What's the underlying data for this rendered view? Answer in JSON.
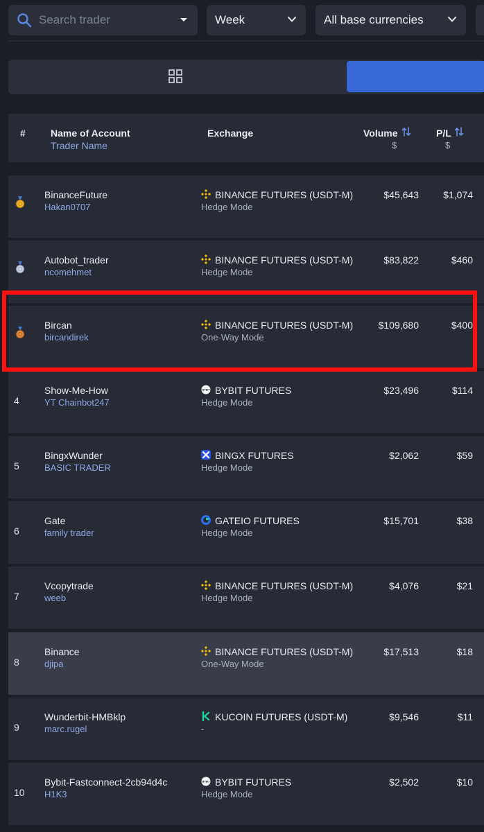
{
  "filters": {
    "search_placeholder": "Search trader",
    "period": "Week",
    "base_currency": "All base currencies"
  },
  "table": {
    "headers": {
      "rank": "#",
      "account": "Name of Account",
      "account_sub": "Trader Name",
      "exchange": "Exchange",
      "volume": "Volume",
      "volume_unit": "$",
      "pl": "P/L",
      "pl_unit": "$"
    },
    "rows": [
      {
        "rank": "",
        "medal": "gold-medal-icon",
        "name": "BinanceFuture",
        "trader": "Hakan0707",
        "exchange_icon": "binance-icon",
        "exchange": "BINANCE FUTURES (USDT-M)",
        "mode": "Hedge Mode",
        "volume": "$45,643",
        "pl": "$1,074"
      },
      {
        "rank": "",
        "medal": "silver-medal-icon",
        "name": "Autobot_trader",
        "trader": "ncomehmet",
        "exchange_icon": "binance-icon",
        "exchange": "BINANCE FUTURES (USDT-M)",
        "mode": "Hedge Mode",
        "volume": "$83,822",
        "pl": "$460"
      },
      {
        "rank": "",
        "medal": "bronze-medal-icon",
        "name": "Bircan",
        "trader": "bircandirek",
        "exchange_icon": "binance-icon",
        "exchange": "BINANCE FUTURES (USDT-M)",
        "mode": "One-Way Mode",
        "volume": "$109,680",
        "pl": "$400"
      },
      {
        "rank": "4",
        "name": "Show-Me-How",
        "trader": "YT Chainbot247",
        "exchange_icon": "bybit-icon",
        "exchange": "BYBIT FUTURES",
        "mode": "Hedge Mode",
        "volume": "$23,496",
        "pl": "$114"
      },
      {
        "rank": "5",
        "name": "BingxWunder",
        "trader": "BASIC TRADER",
        "exchange_icon": "bingx-icon",
        "exchange": "BINGX FUTURES",
        "mode": "Hedge Mode",
        "volume": "$2,062",
        "pl": "$59"
      },
      {
        "rank": "6",
        "name": "Gate",
        "trader": "family trader",
        "exchange_icon": "gateio-icon",
        "exchange": "GATEIO FUTURES",
        "mode": "Hedge Mode",
        "volume": "$15,701",
        "pl": "$38"
      },
      {
        "rank": "7",
        "name": "Vcopytrade",
        "trader": "weeb",
        "exchange_icon": "binance-icon",
        "exchange": "BINANCE FUTURES (USDT-M)",
        "mode": "Hedge Mode",
        "volume": "$4,076",
        "pl": "$21"
      },
      {
        "rank": "8",
        "name": "Binance",
        "trader": "djipa",
        "exchange_icon": "binance-icon",
        "exchange": "BINANCE FUTURES (USDT-M)",
        "mode": "One-Way Mode",
        "volume": "$17,513",
        "pl": "$18"
      },
      {
        "rank": "9",
        "name": "Wunderbit-HMBklp",
        "trader": "marc.rugel",
        "exchange_icon": "kucoin-icon",
        "exchange": "KUCOIN FUTURES (USDT-M)",
        "mode": "-",
        "volume": "$9,546",
        "pl": "$11"
      },
      {
        "rank": "10",
        "name": "Bybit-Fastconnect-2cb94d4c",
        "trader": "H1K3",
        "exchange_icon": "bybit-icon",
        "exchange": "BYBIT FUTURES",
        "mode": "Hedge Mode",
        "volume": "$2,502",
        "pl": "$10"
      }
    ]
  },
  "colors": {
    "accent": "#3868d6",
    "highlight_box": "#ff1010",
    "link_text": "#8fa8e6",
    "binance": "#f0b90b"
  }
}
